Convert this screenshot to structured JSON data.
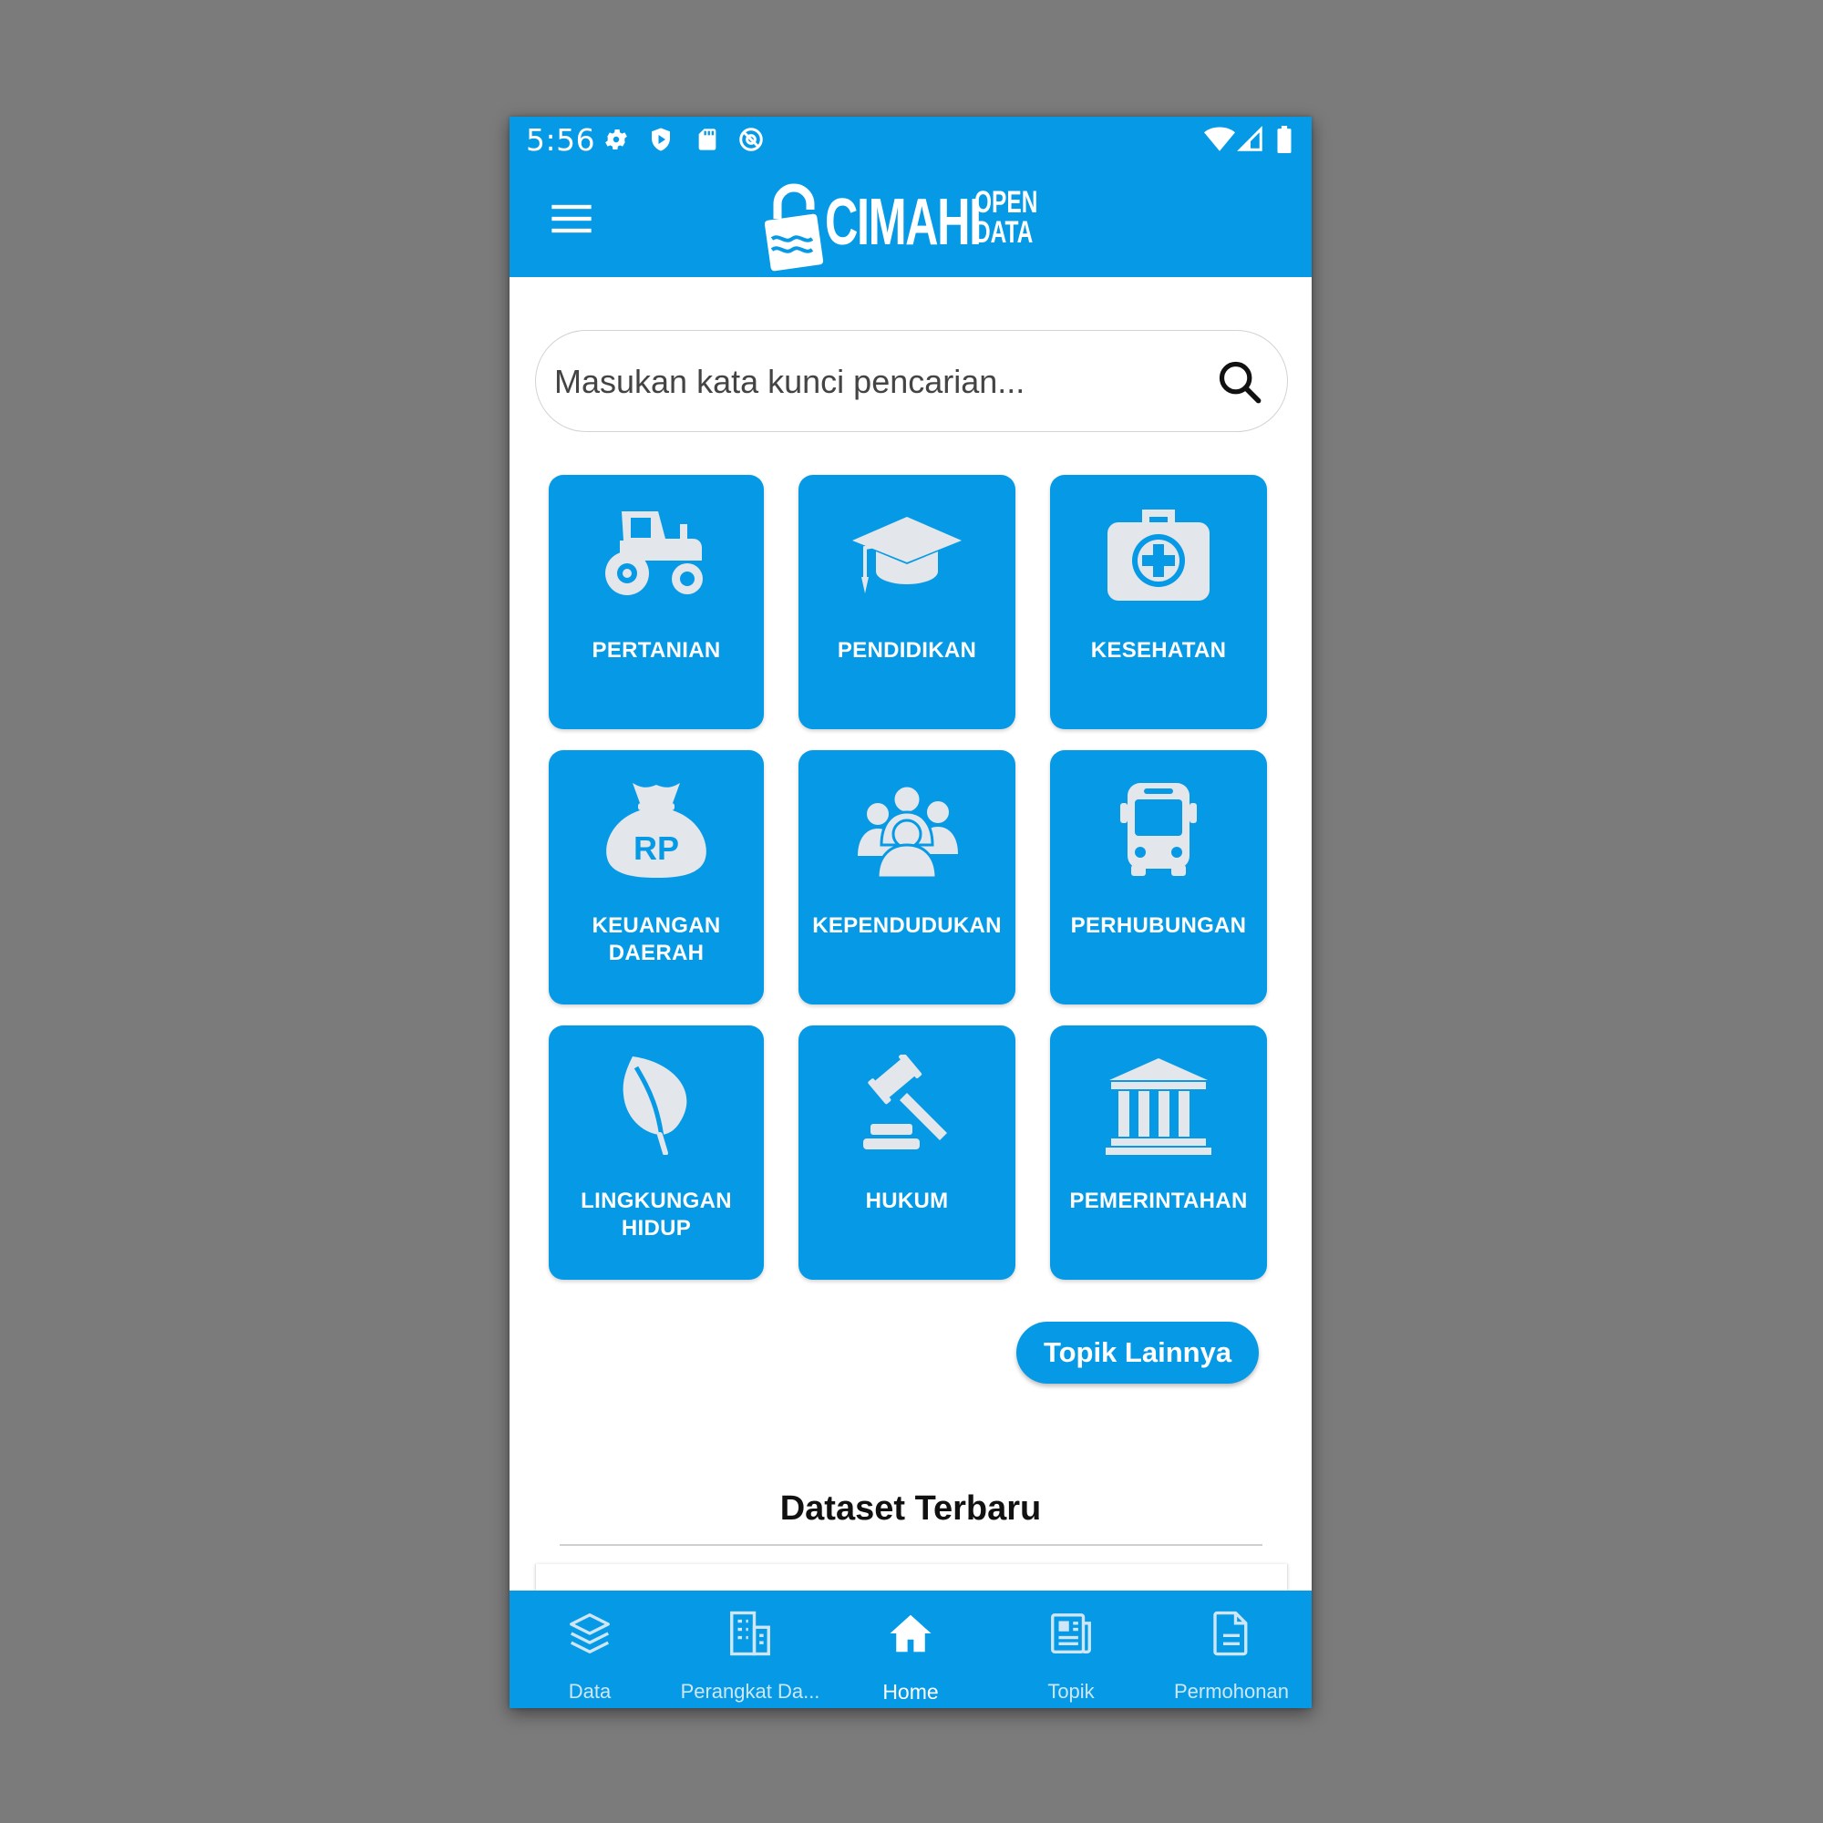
{
  "status_bar": {
    "time": "5:56",
    "left_icons": [
      "gear-icon",
      "shield-icon",
      "sd-card-icon",
      "at-sync-icon"
    ],
    "right_icons": [
      "wifi-icon",
      "cellular-icon",
      "battery-icon"
    ]
  },
  "app_bar": {
    "menu_icon": "hamburger-icon",
    "logo": {
      "main": "CIMAHI",
      "sub_top": "OPEN",
      "sub_bottom": "DATA"
    }
  },
  "search": {
    "placeholder": "Masukan kata kunci pencarian...",
    "value": "",
    "icon": "search-icon"
  },
  "topics": [
    {
      "label": "PERTANIAN",
      "icon": "tractor-icon"
    },
    {
      "label": "PENDIDIKAN",
      "icon": "graduation-cap-icon"
    },
    {
      "label": "KESEHATAN",
      "icon": "first-aid-kit-icon"
    },
    {
      "label": "KEUANGAN DAERAH",
      "icon": "money-bag-icon",
      "icon_text": "RP"
    },
    {
      "label": "KEPENDUDUKAN",
      "icon": "people-icon"
    },
    {
      "label": "PERHUBUNGAN",
      "icon": "bus-icon"
    },
    {
      "label": "LINGKUNGAN HIDUP",
      "icon": "leaf-icon"
    },
    {
      "label": "HUKUM",
      "icon": "gavel-icon"
    },
    {
      "label": "PEMERINTAHAN",
      "icon": "government-building-icon"
    }
  ],
  "more_topics_button": "Topik Lainnya",
  "latest_section": {
    "title": "Dataset Terbaru"
  },
  "bottom_nav": [
    {
      "label": "Data",
      "icon": "layers-icon",
      "active": false
    },
    {
      "label": "Perangkat Da...",
      "icon": "buildings-icon",
      "active": false
    },
    {
      "label": "Home",
      "icon": "home-icon",
      "active": true
    },
    {
      "label": "Topik",
      "icon": "newspaper-icon",
      "active": false
    },
    {
      "label": "Permohonan",
      "icon": "document-icon",
      "active": false
    }
  ],
  "colors": {
    "primary": "#069ae6",
    "icon_grey": "#e3e6ea",
    "background": "#7b7b7b"
  }
}
